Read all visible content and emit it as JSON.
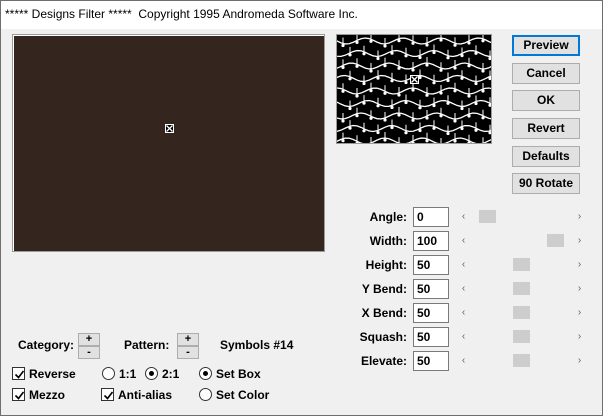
{
  "window": {
    "title": "***** Designs Filter *****  Copyright 1995 Andromeda Software Inc."
  },
  "buttons": {
    "preview": "Preview",
    "cancel": "Cancel",
    "ok": "OK",
    "revert": "Revert",
    "defaults": "Defaults",
    "rotate": "90 Rotate"
  },
  "params": [
    {
      "key": "angle",
      "label": "Angle:",
      "value": "0",
      "slider_fraction": 0.1
    },
    {
      "key": "width",
      "label": "Width:",
      "value": "100",
      "slider_fraction": 0.9
    },
    {
      "key": "height",
      "label": "Height:",
      "value": "50",
      "slider_fraction": 0.5
    },
    {
      "key": "ybend",
      "label": "Y Bend:",
      "value": "50",
      "slider_fraction": 0.5
    },
    {
      "key": "xbend",
      "label": "X Bend:",
      "value": "50",
      "slider_fraction": 0.5
    },
    {
      "key": "squash",
      "label": "Squash:",
      "value": "50",
      "slider_fraction": 0.5
    },
    {
      "key": "elevate",
      "label": "Elevate:",
      "value": "50",
      "slider_fraction": 0.5
    }
  ],
  "category": {
    "label": "Category:"
  },
  "pattern": {
    "label": "Pattern:",
    "value": "Symbols #14"
  },
  "stepper": {
    "plus": "+",
    "minus": "-"
  },
  "options": {
    "reverse": {
      "label": "Reverse",
      "checked": true
    },
    "mezzo": {
      "label": "Mezzo",
      "checked": true
    },
    "antialias": {
      "label": "Anti-alias",
      "checked": true
    },
    "ratio_1_1": {
      "label": "1:1",
      "selected": false
    },
    "ratio_2_1": {
      "label": "2:1",
      "selected": true
    },
    "set_box": {
      "label": "Set Box",
      "selected": true
    },
    "set_color": {
      "label": "Set Color",
      "selected": false
    }
  },
  "colors": {
    "preview_background": "#35251f",
    "focus_border": "#0078d7"
  },
  "icons": {
    "crosshair": "crosshair-icon",
    "scroll_left": "chevron-left-icon",
    "scroll_right": "chevron-right-icon"
  }
}
